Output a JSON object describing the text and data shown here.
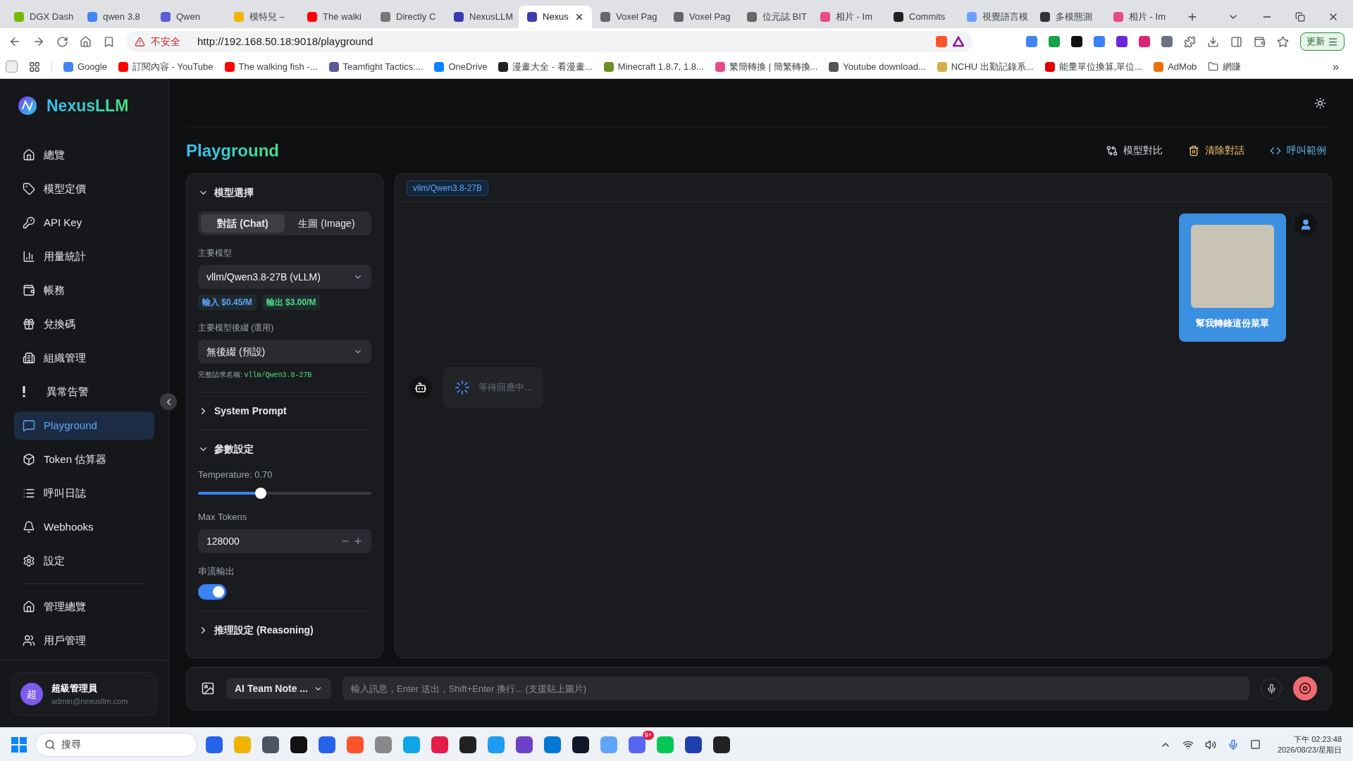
{
  "browser": {
    "tabs": [
      {
        "title": "DGX Dash",
        "selected": false
      },
      {
        "title": "qwen 3.8",
        "selected": false
      },
      {
        "title": "Qwen",
        "selected": false
      },
      {
        "title": "模特兒 –",
        "selected": false
      },
      {
        "title": "The walki",
        "selected": false
      },
      {
        "title": "Directly C",
        "selected": false
      },
      {
        "title": "NexusLLM",
        "selected": false
      },
      {
        "title": "Nexus",
        "selected": true
      },
      {
        "title": "Voxel Pag",
        "selected": false
      },
      {
        "title": "Voxel Pag",
        "selected": false
      },
      {
        "title": "位元誌 BIT",
        "selected": false
      },
      {
        "title": "相片 - Im",
        "selected": false
      },
      {
        "title": "Commits",
        "selected": false
      },
      {
        "title": "視覺語言模",
        "selected": false
      },
      {
        "title": "多模態測",
        "selected": false
      },
      {
        "title": "相片 - Im",
        "selected": false
      }
    ],
    "security_label": "不安全",
    "url": "http://192.168.50.18:9018/playground",
    "update_button": "更新",
    "bookmarks": [
      "Google",
      "訂閱內容 - YouTube",
      "The walking fish -...",
      "Teamfight Tactics:...",
      "OneDrive",
      "漫畫大全 - 看漫畫...",
      "Minecraft 1.8.7, 1.8...",
      "繁簡轉換 | 簡繁轉換...",
      "Youtube download...",
      "NCHU 出勤記錄系...",
      "能量單位換算,單位...",
      "AdMob",
      "網賺"
    ],
    "bookmarks_more": "»"
  },
  "sidebar": {
    "brand": "NexusLLM",
    "items": [
      {
        "label": "總覽",
        "selected": false
      },
      {
        "label": "模型定價",
        "selected": false
      },
      {
        "label": "API Key",
        "selected": false
      },
      {
        "label": "用量統計",
        "selected": false
      },
      {
        "label": "帳務",
        "selected": false
      },
      {
        "label": "兌換碼",
        "selected": false
      },
      {
        "label": "組織管理",
        "selected": false
      },
      {
        "label": "異常告警",
        "selected": false
      },
      {
        "label": "Playground",
        "selected": true
      },
      {
        "label": "Token 估算器",
        "selected": false
      },
      {
        "label": "呼叫日誌",
        "selected": false
      },
      {
        "label": "Webhooks",
        "selected": false
      },
      {
        "label": "設定",
        "selected": false
      }
    ],
    "admin_items": [
      {
        "label": "管理總覽",
        "selected": false
      },
      {
        "label": "用戶管理",
        "selected": false
      }
    ],
    "user": {
      "avatar": "超",
      "name": "超級管理員",
      "email": "admin@nexusllm.com"
    }
  },
  "page": {
    "title": "Playground",
    "actions": [
      {
        "label": "模型對比",
        "kind": "compare"
      },
      {
        "label": "清除對話",
        "kind": "clear"
      },
      {
        "label": "呼叫範例",
        "kind": "code"
      }
    ]
  },
  "settings": {
    "model_section": {
      "title": "模型選擇",
      "expanded": true
    },
    "modes": [
      {
        "label": "對話 (Chat)",
        "selected": true
      },
      {
        "label": "生圖 (Image)",
        "selected": false
      }
    ],
    "main_model_label": "主要模型",
    "main_model": "vllm/Qwen3.8-27B (vLLM)",
    "prices": [
      {
        "text": "輸入 $0.45/M",
        "color": "#60a5fa"
      },
      {
        "text": "輸出 $3.00/M",
        "color": "#4ade80"
      }
    ],
    "suffix_label": "主要模型後綴 (選用)",
    "suffix": "無後綴 (預設)",
    "full_name_label": "完整請求名稱:",
    "full_name": "vllm/Qwen3.8-27B",
    "system_prompt": {
      "title": "System Prompt",
      "expanded": false
    },
    "params_section": {
      "title": "參數設定",
      "expanded": true
    },
    "temperature_label": "Temperature: 0.70",
    "temperature": {
      "level": 0.36
    },
    "max_tokens_label": "Max Tokens",
    "max_tokens": "128000",
    "stream_label": "串流輸出",
    "stream": {
      "on": true
    },
    "reasoning": {
      "title": "推理設定 (Reasoning)",
      "expanded": false
    }
  },
  "chat": {
    "model_tag": "vllm/Qwen3.8-27B",
    "messages": [
      {
        "kind": "user",
        "text": "幫我轉錄這份菜單"
      },
      {
        "kind": "assistant",
        "text": "等待回應中..."
      }
    ]
  },
  "composer": {
    "mode": "AI Team Note ...",
    "placeholder": "輸入訊息，Enter 送出，Shift+Enter 換行... (支援貼上圖片)"
  },
  "taskbar": {
    "search_placeholder": "搜尋",
    "time": "下午 02:23:48",
    "date": "2026/08/23/星期日",
    "badge": "9+"
  }
}
